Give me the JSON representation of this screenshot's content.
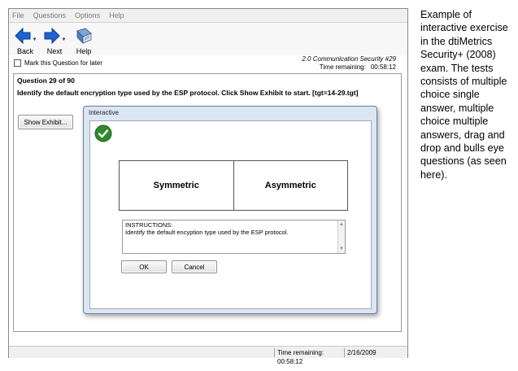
{
  "menu": [
    "File",
    "Questions",
    "Options",
    "Help"
  ],
  "toolbar": {
    "back_label": "Back",
    "next_label": "Next",
    "help_label": "Help"
  },
  "mark_later_label": "Mark this Question for later",
  "topic": "2.0 Communication Security #29",
  "time_remaining_label": "Time remaining:",
  "time_remaining_value": "00:58:12",
  "question": {
    "number": "Question 29 of 90",
    "text": "Identify the default encryption type used by the ESP protocol. Click Show Exhibit to start. [tgt=14-29.tgt]"
  },
  "show_exhibit_label": "Show Exhibit...",
  "dialog": {
    "title": "Interactive",
    "choices": [
      "Symmetric",
      "Asymmetric"
    ],
    "instructions_heading": "INSTRUCTIONS:",
    "instructions_text": "Identify the default encyption type used by the ESP protocol.",
    "ok_label": "OK",
    "cancel_label": "Cancel"
  },
  "status": {
    "time": "Time remaining: 00:58:12",
    "date": "2/16/2009"
  },
  "caption": "Example of interactive exercise in the dtiMetrics Security+ (2008) exam. The tests consists of multiple choice single answer, multiple choice multiple answers, drag and drop and bulls eye questions (as seen here).",
  "colors": {
    "nav_arrow": "#1d63d6",
    "check_green": "#2e8b2e",
    "dialog_frame": "#dbe6f3"
  }
}
